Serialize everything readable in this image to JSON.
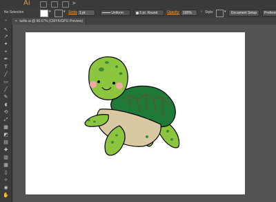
{
  "app": {
    "logo": "Ai"
  },
  "control_bar": {
    "selection_label": "No Selection",
    "stroke_label": "Stroke:",
    "stroke_weight": "1 pt",
    "profile": "Uniform",
    "brush": "5 pt. Round",
    "opacity_label": "Opacity:",
    "opacity_value": "100%",
    "style_label": "Style:",
    "document_setup": "Document Setup",
    "preferences": "Preferences",
    "fill_color": "#ffffff",
    "stroke_color": "#ffffff"
  },
  "document_tab": {
    "label": "turtle.ai @ 66.67% (CMYK/GPU Preview)",
    "close": "×"
  },
  "toolbar": {
    "collapse": "»",
    "tools": [
      "↖",
      "↗",
      "✦",
      "⌖",
      "✒",
      "T",
      "╱",
      "▭",
      "╱",
      "✎",
      "◖",
      "⟲",
      "⤢",
      "▦",
      "◩",
      "▤",
      "✚",
      "▥",
      "▦",
      "▯",
      "✧",
      "◉",
      "✋",
      "🔍"
    ]
  },
  "artwork": {
    "colors": {
      "skin": "#8cc63f",
      "shell": "#1f7a3a",
      "belly": "#d9c9a3",
      "spots": "#3f8a3a",
      "cheeks": "#f5a8a8",
      "outline": "#000000"
    }
  }
}
